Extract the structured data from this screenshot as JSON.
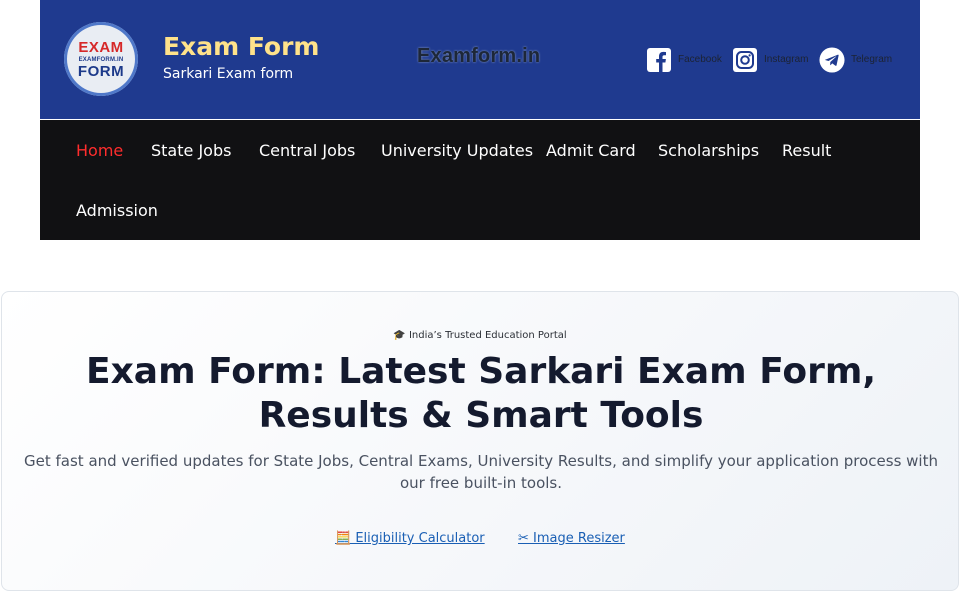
{
  "header": {
    "logo_top": "EXAM",
    "logo_middle": "EXAMFORM.IN",
    "logo_bottom": "FORM",
    "site_title": "Exam Form",
    "tagline": "Sarkari Exam form",
    "brand_center": "Examform.in",
    "social": [
      {
        "label": "Facebook",
        "icon": "facebook-icon"
      },
      {
        "label": "Instagram",
        "icon": "instagram-icon"
      },
      {
        "label": "Telegram",
        "icon": "telegram-icon"
      }
    ]
  },
  "nav": {
    "items": [
      {
        "label": "Home",
        "active": true
      },
      {
        "label": "State Jobs"
      },
      {
        "label": "Central Jobs"
      },
      {
        "label": "University Updates"
      },
      {
        "label": "Admit Card"
      },
      {
        "label": "Scholarships"
      },
      {
        "label": "Result"
      },
      {
        "label": "Admission"
      }
    ]
  },
  "hero": {
    "badge": "🎓 India’s Trusted Education Portal",
    "title": "Exam Form: Latest Sarkari Exam Form, Results & Smart Tools",
    "description": "Get fast and verified updates for State Jobs, Central Exams, University Results, and simplify your application process with our free built-in tools.",
    "links": [
      {
        "label": "🧮 Eligibility Calculator"
      },
      {
        "label": "✂ Image Resizer"
      }
    ]
  },
  "colors": {
    "header_bg": "#1f3a8f",
    "nav_bg": "#111113",
    "nav_active": "#ff2d2d",
    "title_accent": "#ffe28a",
    "link": "#1a5fb4"
  }
}
